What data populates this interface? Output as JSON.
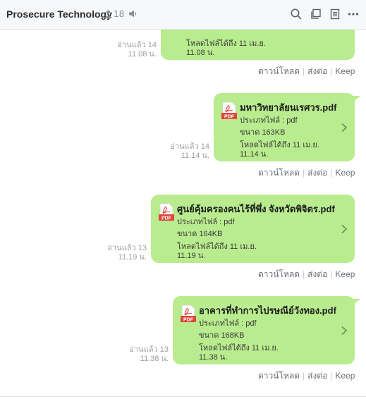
{
  "header": {
    "title": "Prosecure Technology",
    "member_count": "18"
  },
  "messages": [
    {
      "file_name": "",
      "type_line": "",
      "size_line": "",
      "expiry_line1": "โหลดไฟล์ได้ถึง 11 เม.ย.",
      "expiry_line2": "11.08 น.",
      "read_line1": "อ่านแล้ว 14",
      "read_line2": "11.08 น."
    },
    {
      "file_name": "มหาวิทยาลัยนเรศวร.pdf",
      "type_line": "ประเภทไฟล์ : pdf",
      "size_line": "ขนาด 163KB",
      "expiry_line1": "โหลดไฟล์ได้ถึง 11 เม.ย.",
      "expiry_line2": "11.14 น.",
      "read_line1": "อ่านแล้ว 14",
      "read_line2": "11.14 น."
    },
    {
      "file_name": "ศูนย์คุ้มครองคนไร้ที่พึ่ง จังหวัดพิจิตร.pdf",
      "type_line": "ประเภทไฟล์ : pdf",
      "size_line": "ขนาด 164KB",
      "expiry_line1": "โหลดไฟล์ได้ถึง 11 เม.ย.",
      "expiry_line2": "11.19 น.",
      "read_line1": "อ่านแล้ว 13",
      "read_line2": "11.19 น."
    },
    {
      "file_name": "อาคารที่ทำการไปรษณีย์วังทอง.pdf",
      "type_line": "ประเภทไฟล์ : pdf",
      "size_line": "ขนาด 168KB",
      "expiry_line1": "โหลดไฟล์ได้ถึง 11 เม.ย.",
      "expiry_line2": "11.38 น.",
      "read_line1": "อ่านแล้ว 13",
      "read_line2": "11.38 น."
    }
  ],
  "actions": {
    "download": "ดาวน์โหลด",
    "share": "ส่งต่อ",
    "keep": "Keep"
  },
  "icons": {
    "members": "person-icon",
    "mute": "speaker-icon",
    "search": "search-icon",
    "chat_copy": "window-icon",
    "notes": "notes-icon",
    "more": "more-icon",
    "pdf": "pdf-file-icon",
    "open": "chevron-right-icon"
  },
  "colors": {
    "bubble": "#b9ec8e",
    "pdf_red": "#e0443a"
  }
}
